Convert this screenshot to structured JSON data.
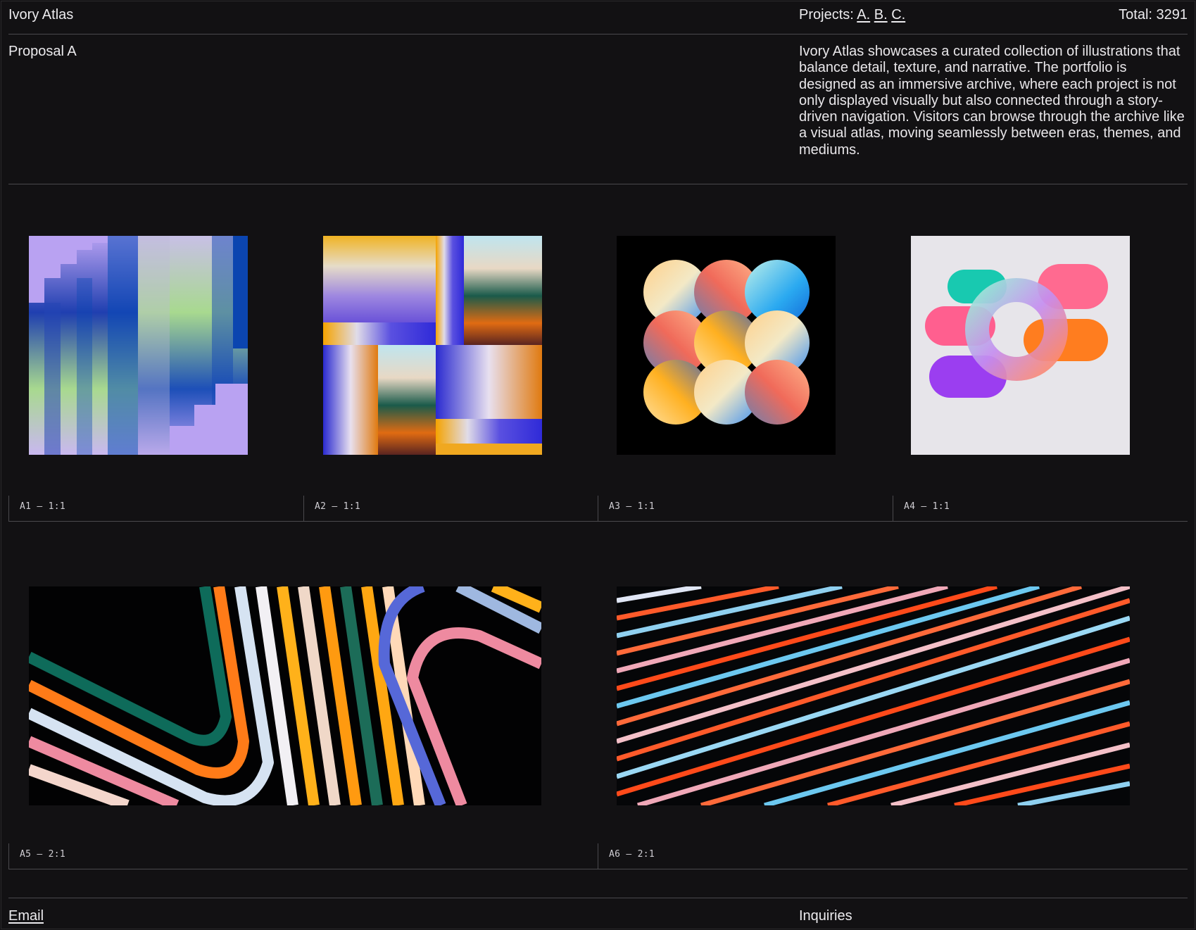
{
  "header": {
    "brand": "Ivory Atlas",
    "projects_label": "Projects:",
    "project_links": [
      "A.",
      "B.",
      "C."
    ],
    "total": "Total: 3291"
  },
  "intro": {
    "title": "Proposal A",
    "description": "Ivory Atlas showcases a curated collection of illustrations that balance detail, texture, and narrative. The portfolio is designed as an immersive archive, where each project is not only displayed visually but also connected through a story-driven navigation. Visitors can browse through the archive like a visual atlas, moving seamlessly between eras, themes, and mediums."
  },
  "gallery": {
    "items": [
      {
        "caption": "A1 — 1:1"
      },
      {
        "caption": "A2 — 1:1"
      },
      {
        "caption": "A3 — 1:1"
      },
      {
        "caption": "A4 — 1:1"
      },
      {
        "caption": "A5 — 2:1"
      },
      {
        "caption": "A6 — 2:1"
      }
    ]
  },
  "footer": {
    "email_label": "Email",
    "inquiries_label": "Inquiries"
  },
  "colors": {
    "background": "#121113",
    "text": "#ecebee",
    "rule": "#4a494d"
  }
}
